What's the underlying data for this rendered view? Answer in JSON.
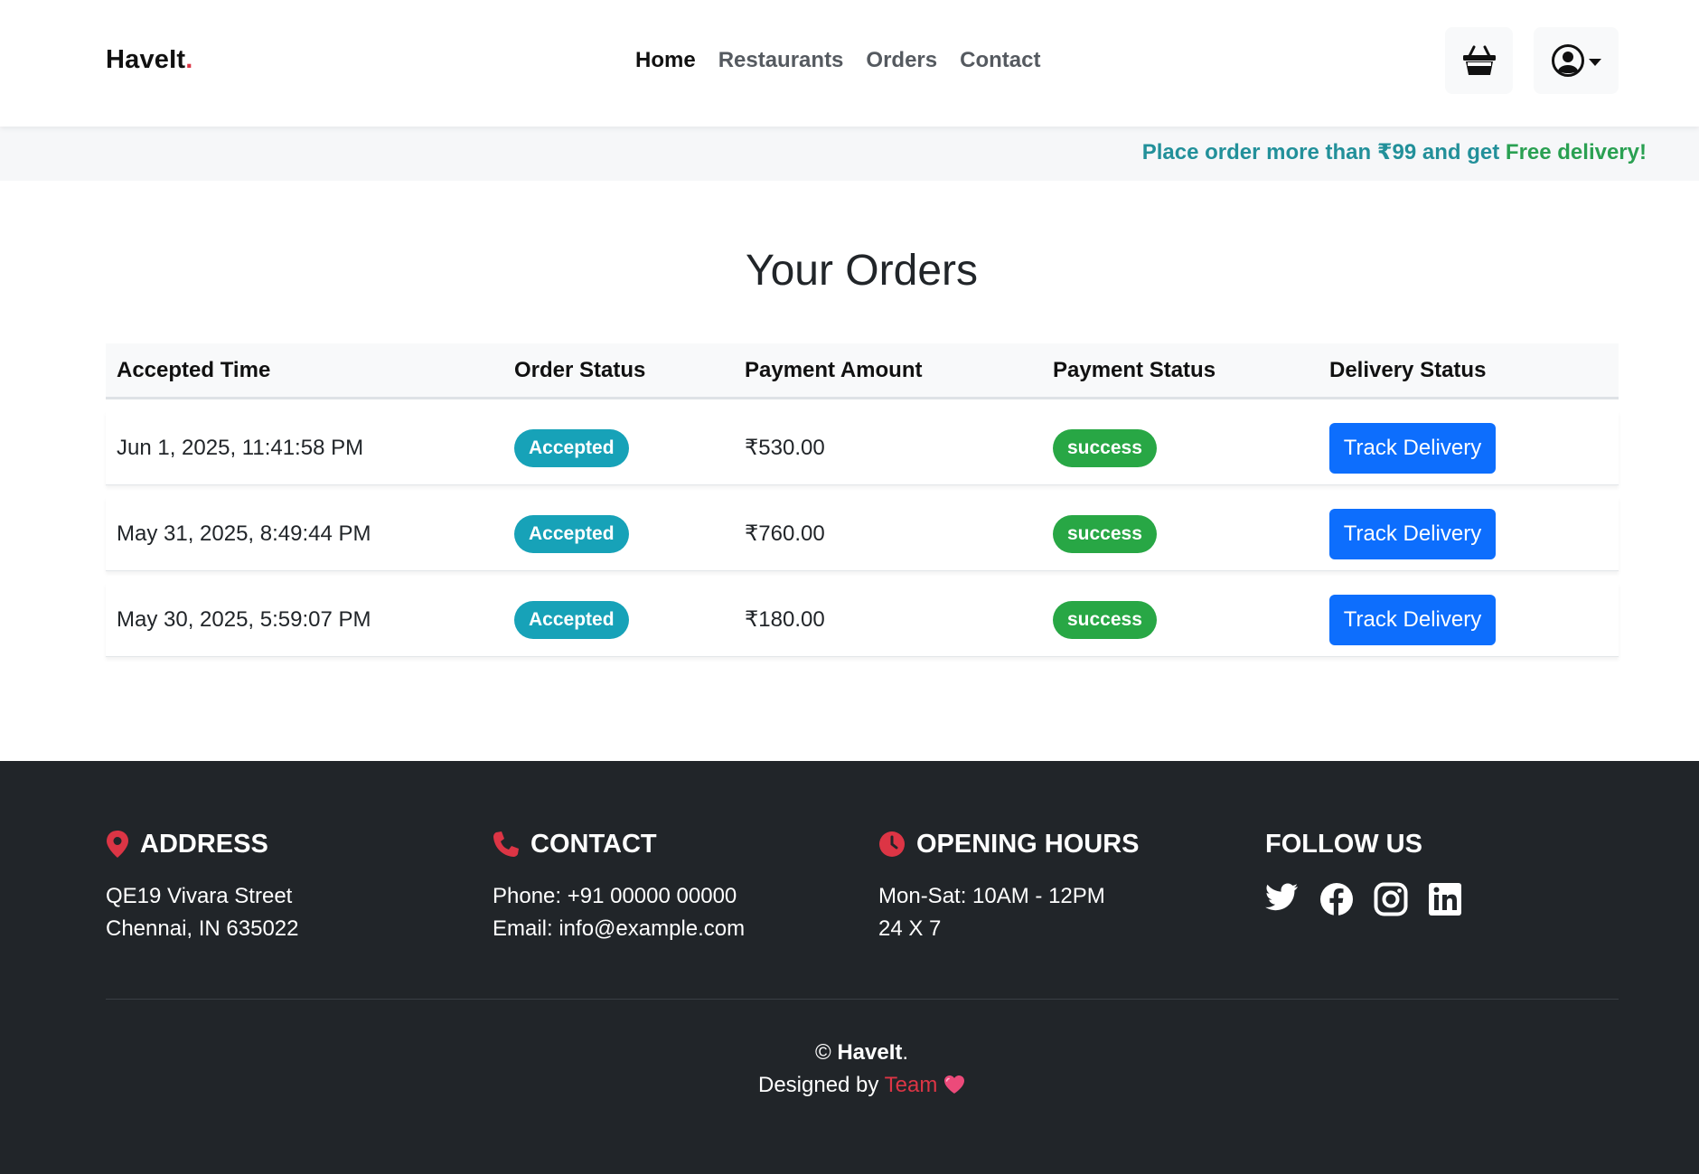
{
  "brand": {
    "name": "HaveIt",
    "dot": "."
  },
  "nav": {
    "links": [
      {
        "label": "Home",
        "active": true
      },
      {
        "label": "Restaurants",
        "active": false
      },
      {
        "label": "Orders",
        "active": false
      },
      {
        "label": "Contact",
        "active": false
      }
    ]
  },
  "header_icons": {
    "cart": "basket-icon",
    "user": "user-circle-icon"
  },
  "promo": {
    "text": "Place order more than ₹99 and get ",
    "highlight": "Free delivery!"
  },
  "page": {
    "title": "Your Orders"
  },
  "table": {
    "headers": [
      "Accepted Time",
      "Order Status",
      "Payment Amount",
      "Payment Status",
      "Delivery Status"
    ],
    "rows": [
      {
        "time": "Jun 1, 2025, 11:41:58 PM",
        "order_status": "Accepted",
        "amount": "₹530.00",
        "payment_status": "success",
        "action": "Track Delivery"
      },
      {
        "time": "May 31, 2025, 8:49:44 PM",
        "order_status": "Accepted",
        "amount": "₹760.00",
        "payment_status": "success",
        "action": "Track Delivery"
      },
      {
        "time": "May 30, 2025, 5:59:07 PM",
        "order_status": "Accepted",
        "amount": "₹180.00",
        "payment_status": "success",
        "action": "Track Delivery"
      }
    ]
  },
  "footer": {
    "address": {
      "title": "ADDRESS",
      "line1": "QE19 Vivara Street",
      "line2": "Chennai, IN 635022",
      "icon": "map-pin-icon"
    },
    "contact": {
      "title": "CONTACT",
      "phone": "Phone: +91 00000 00000",
      "email": "Email: info@example.com",
      "icon": "phone-icon"
    },
    "hours": {
      "title": "OPENING HOURS",
      "line1": "Mon-Sat: 10AM - 12PM",
      "line2": "24 X 7",
      "icon": "clock-icon"
    },
    "follow": {
      "title": "FOLLOW US",
      "icons": [
        "twitter-icon",
        "facebook-icon",
        "instagram-icon",
        "linkedin-icon"
      ]
    },
    "copyright_symbol": "©",
    "copyright_brand": "HaveIt",
    "copyright_dot": ".",
    "designed_by": "Designed by ",
    "team": "Team"
  },
  "colors": {
    "accent_red": "#dc3545",
    "primary_blue": "#0d6efd",
    "badge_info": "#17a2b8",
    "badge_success": "#28a745",
    "promo_teal": "#22909a",
    "promo_green": "#2aa052",
    "footer_bg": "#212529"
  }
}
